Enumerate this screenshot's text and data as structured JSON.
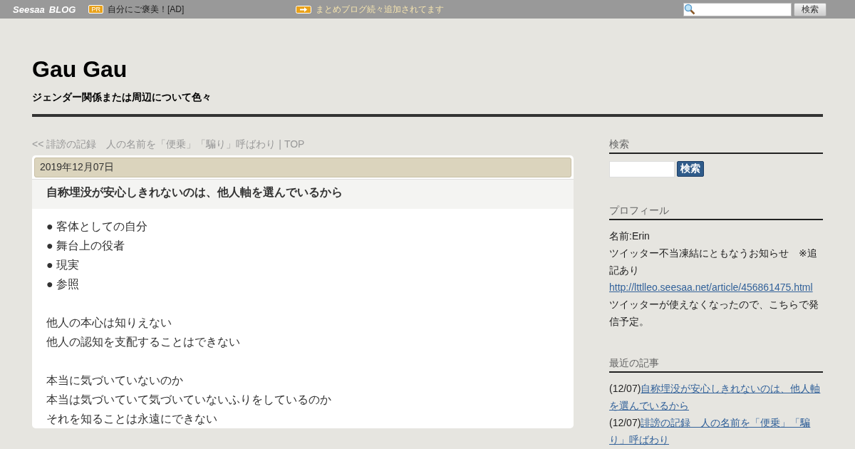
{
  "topbar": {
    "logo": [
      "Seesaa",
      "BLOG"
    ],
    "pr_badge": "PR",
    "ad_text": "自分にご褒美！[AD]",
    "notice": "まとめブログ続々追加されてます",
    "search_button": "検索"
  },
  "blog": {
    "title": "Gau Gau",
    "subtitle": "ジェンダー関係または周辺について色々"
  },
  "nav": {
    "prev": "<< 誹謗の記録　人の名前を「便乗」「騙り」呼ばわり",
    "separator": "|",
    "top": "TOP"
  },
  "article": {
    "date": "2019年12月07日",
    "title": "自称埋没が安心しきれないのは、他人軸を選んでいるから",
    "paragraphs": [
      [
        "● 客体としての自分",
        "● 舞台上の役者",
        "● 現実",
        "● 参照"
      ],
      [
        "他人の本心は知りえない",
        "他人の認知を支配することはできない"
      ],
      [
        "本当に気づいていないのか",
        "本当は気づいていて気づいていないふりをしているのか",
        "それを知ることは永遠にできない"
      ]
    ]
  },
  "sidebar": {
    "search": {
      "heading": "検索",
      "button": "検索"
    },
    "profile": {
      "heading": "プロフィール",
      "lines": [
        {
          "kind": "text",
          "text": "名前:Erin"
        },
        {
          "kind": "text",
          "text": "ツイッター不当凍結にともなうお知らせ　※追記あり"
        },
        {
          "kind": "link",
          "text": "http://lttlleo.seesaa.net/article/456861475.html"
        },
        {
          "kind": "text",
          "text": "ツイッターが使えなくなったので、こちらで発信予定。"
        }
      ]
    },
    "recent": {
      "heading": "最近の記事",
      "items": [
        {
          "date": "(12/07)",
          "title": "自称埋没が安心しきれないのは、他人軸を選んでいるから"
        },
        {
          "date": "(12/07)",
          "title": "誹謗の記録　人の名前を「便乗」「騙り」呼ばわり"
        }
      ]
    }
  }
}
